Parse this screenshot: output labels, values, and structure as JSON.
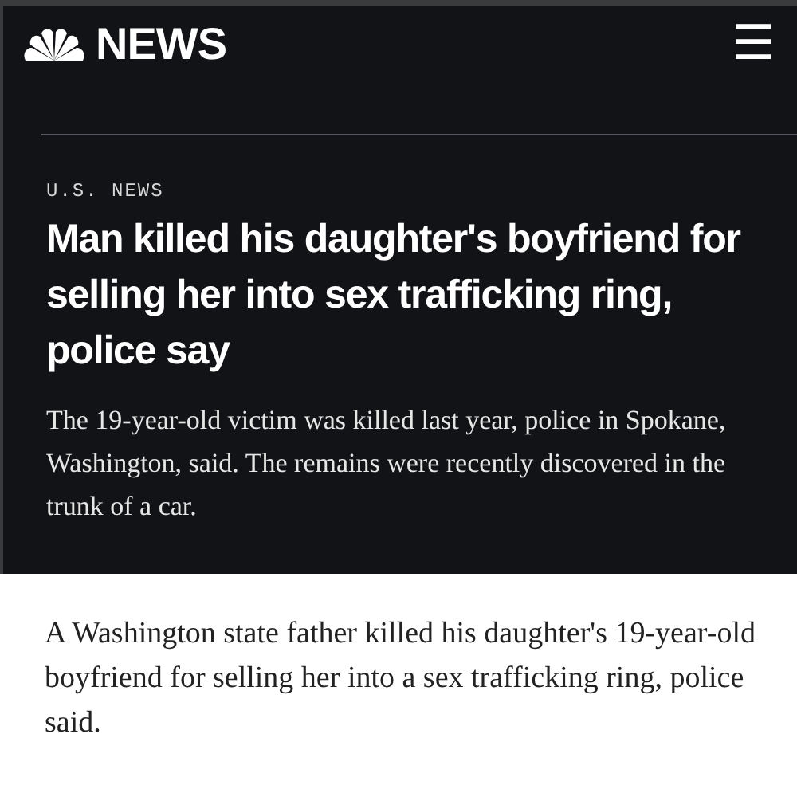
{
  "header": {
    "logo_text": "NEWS",
    "menu": "☰"
  },
  "article": {
    "section": "U.S. NEWS",
    "headline": "Man killed his daughter's boyfriend for selling her into sex trafficking ring, police say",
    "dek": "The 19-year-old victim was killed last year, police in Spokane, Washington, said. The remains were recently discovered in the trunk of a car.",
    "body": "A Washington state father killed his daughter's 19-year-old boyfriend for selling her into a sex trafficking ring, police said."
  }
}
